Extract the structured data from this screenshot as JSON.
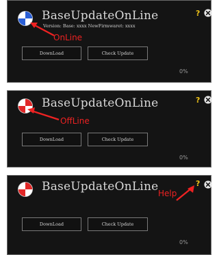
{
  "panels": [
    {
      "title": "BaseUpdateOnLine",
      "version": "Version: Base: xxxx NewFirmwaret: xxxx",
      "download_label": "DownLoad",
      "check_label": "Check Update",
      "progress_text": "0%",
      "help_icon": "?",
      "status": "online",
      "logo_colors": [
        "#2a5fd6",
        "#ffffff"
      ]
    },
    {
      "title": "BaseUpdateOnLine",
      "download_label": "DownLoad",
      "check_label": "Check Update",
      "progress_text": "0%",
      "help_icon": "?",
      "status": "offline",
      "logo_colors": [
        "#e02828",
        "#ffffff"
      ]
    },
    {
      "title": "BaseUpdateOnLine",
      "download_label": "DownLoad",
      "check_label": "Check Update",
      "progress_text": "0%",
      "help_icon": "?",
      "status": "offline",
      "logo_colors": [
        "#e02828",
        "#ffffff"
      ]
    }
  ],
  "annotations": {
    "online": "OnLine",
    "offline": "OffLine",
    "help": "Help"
  },
  "colors": {
    "annotation": "#ee2222",
    "help": "#f0c419",
    "panel_bg": "#141414"
  }
}
